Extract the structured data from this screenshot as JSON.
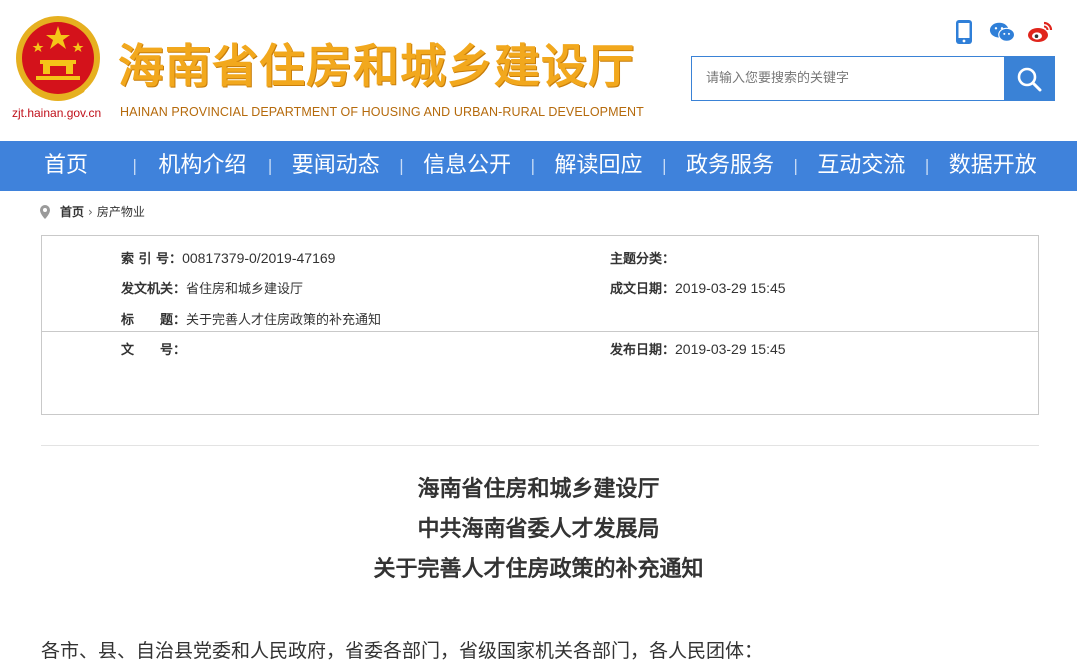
{
  "header": {
    "domain": "zjt.hainan.gov.cn",
    "title": "海南省住房和城乡建设厅",
    "subtitle": "HAINAN PROVINCIAL DEPARTMENT OF HOUSING AND URBAN-RURAL DEVELOPMENT",
    "icons": [
      "mobile-icon",
      "wechat-icon",
      "weibo-icon"
    ]
  },
  "search": {
    "placeholder": "请输入您要搜索的关键字"
  },
  "nav": {
    "items": [
      "首页",
      "机构介绍",
      "要闻动态",
      "信息公开",
      "解读回应",
      "政务服务",
      "互动交流",
      "数据开放"
    ]
  },
  "breadcrumb": {
    "home": "首页",
    "current": "房产物业"
  },
  "info": {
    "index_label": "索 引 号：",
    "index_value": "00817379-0/2019-47169",
    "topic_label": "主题分类：",
    "topic_value": "",
    "issuer_label": "发文机关：",
    "issuer_value": "省住房和城乡建设厅",
    "created_label": "成文日期：",
    "created_value": "2019-03-29 15:45",
    "title_label": "标　　题：",
    "title_value": "关于完善人才住房政策的补充通知",
    "docno_label": "文　　号：",
    "docno_value": "",
    "published_label": "发布日期：",
    "published_value": "2019-03-29 15:45"
  },
  "document": {
    "title_lines": [
      "海南省住房和城乡建设厅",
      "中共海南省委人才发展局",
      "关于完善人才住房政策的补充通知"
    ],
    "first_paragraph": "各市、县、自治县党委和人民政府，省委各部门，省级国家机关各部门，各人民团体："
  },
  "colors": {
    "nav": "#3f82db",
    "title_gold": "#f2a81d",
    "emblem_red": "#d4121b"
  }
}
